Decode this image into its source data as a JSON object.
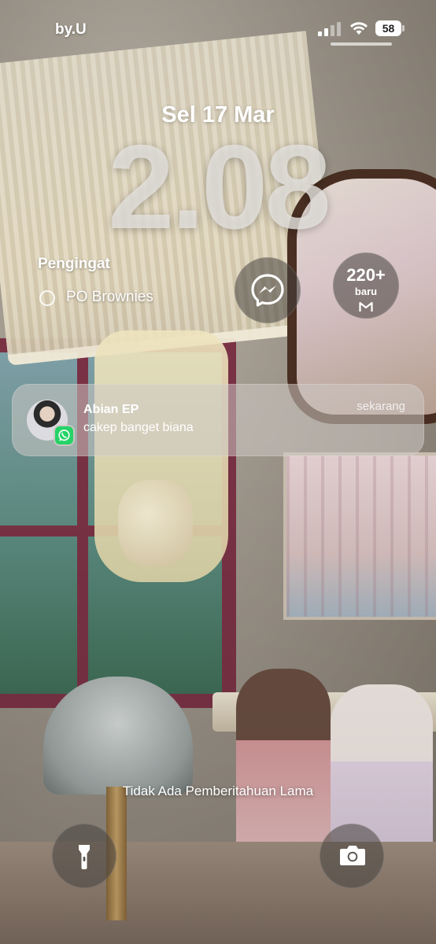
{
  "status_bar": {
    "carrier": "by.U",
    "battery": "58"
  },
  "lock_screen": {
    "date": "Sel 17 Mar",
    "time": "2.08"
  },
  "reminders_widget": {
    "title": "Pengingat",
    "item": "PO Brownies"
  },
  "mail_widget": {
    "count": "220+",
    "label": "baru"
  },
  "notification": {
    "sender": "Abian EP",
    "message": "cakep banget biana",
    "time": "sekarang",
    "app_icon": "whatsapp-icon"
  },
  "footer": {
    "no_older": "Tidak Ada Pemberitahuan Lama"
  },
  "icons": {
    "flashlight": "flashlight-icon",
    "camera": "camera-icon",
    "messenger": "messenger-icon",
    "gmail": "gmail-icon"
  }
}
